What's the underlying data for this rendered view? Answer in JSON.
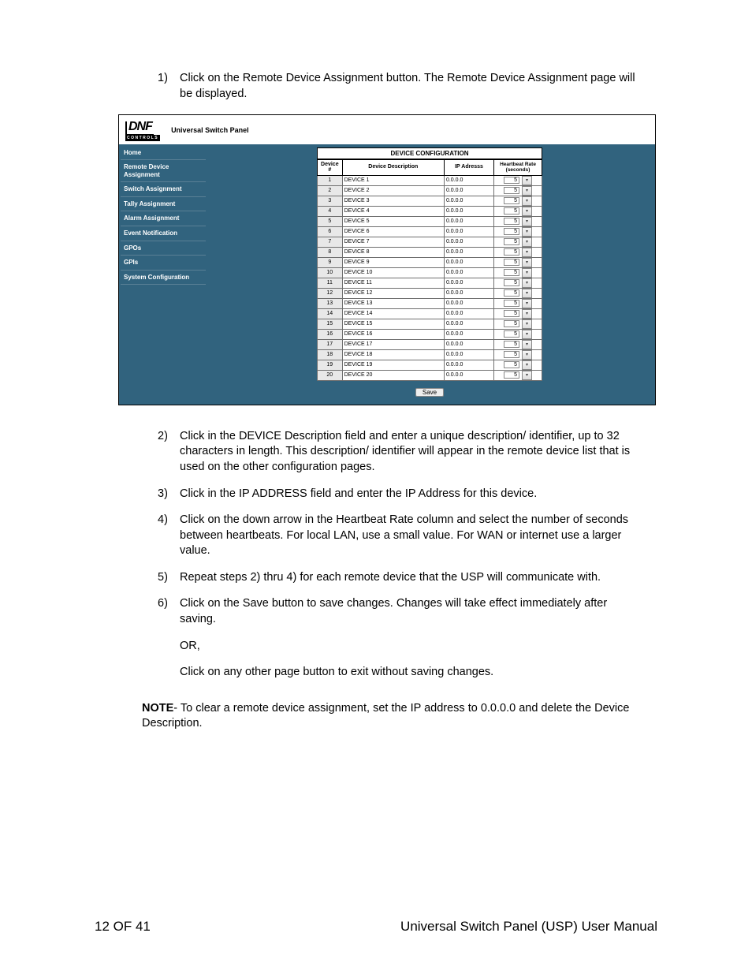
{
  "instructions": {
    "i1": {
      "num": "1)",
      "text": "Click on the Remote Device Assignment button. The Remote Device Assignment page will be displayed."
    },
    "i2": {
      "num": "2)",
      "text": "Click in the DEVICE Description field and enter a unique description/ identifier, up to 32 characters in length.  This description/ identifier will appear in the remote device list that is used on the other configuration pages."
    },
    "i3": {
      "num": "3)",
      "text": "Click in the IP ADDRESS field and enter the IP Address for this device."
    },
    "i4": {
      "num": "4)",
      "text": "Click on the down arrow in the Heartbeat Rate column and select the number of seconds between heartbeats.  For local LAN, use a small value.  For WAN or internet use a larger value."
    },
    "i5": {
      "num": "5)",
      "text": "Repeat steps 2) thru 4) for each remote device that the USP will communicate with."
    },
    "i6": {
      "num": "6)",
      "text": "Click on the Save button to save changes.  Changes will take effect immediately after saving."
    },
    "or": "OR,",
    "sub": "Click on any other page button to exit without saving changes."
  },
  "note_label": "NOTE",
  "note_text": "- To clear a remote device assignment, set the IP address to 0.0.0.0 and delete the Device Description.",
  "screenshot": {
    "logo_main": "DNF",
    "logo_sub": "CONTROLS",
    "top_title": "Universal Switch Panel",
    "sidebar": [
      "Home",
      "Remote Device Assignment",
      "Switch Assignment",
      "Tally Assignment",
      "Alarm Assignment",
      "Event Notification",
      "GPOs",
      "GPIs",
      "System Configuration"
    ],
    "config_title": "DEVICE CONFIGURATION",
    "headers": {
      "num": "Device #",
      "desc": "Device Description",
      "ip": "IP Adresss",
      "hb": "Heartbeat Rate (seconds)"
    },
    "rows": [
      {
        "n": "1",
        "d": "DEVICE 1",
        "ip": "0.0.0.0",
        "hb": "5"
      },
      {
        "n": "2",
        "d": "DEVICE 2",
        "ip": "0.0.0.0",
        "hb": "5"
      },
      {
        "n": "3",
        "d": "DEVICE 3",
        "ip": "0.0.0.0",
        "hb": "5"
      },
      {
        "n": "4",
        "d": "DEVICE 4",
        "ip": "0.0.0.0",
        "hb": "5"
      },
      {
        "n": "5",
        "d": "DEVICE 5",
        "ip": "0.0.0.0",
        "hb": "5"
      },
      {
        "n": "6",
        "d": "DEVICE 6",
        "ip": "0.0.0.0",
        "hb": "5"
      },
      {
        "n": "7",
        "d": "DEVICE 7",
        "ip": "0.0.0.0",
        "hb": "5"
      },
      {
        "n": "8",
        "d": "DEVICE 8",
        "ip": "0.0.0.0",
        "hb": "5"
      },
      {
        "n": "9",
        "d": "DEVICE 9",
        "ip": "0.0.0.0",
        "hb": "5"
      },
      {
        "n": "10",
        "d": "DEVICE 10",
        "ip": "0.0.0.0",
        "hb": "5"
      },
      {
        "n": "11",
        "d": "DEVICE 11",
        "ip": "0.0.0.0",
        "hb": "5"
      },
      {
        "n": "12",
        "d": "DEVICE 12",
        "ip": "0.0.0.0",
        "hb": "5"
      },
      {
        "n": "13",
        "d": "DEVICE 13",
        "ip": "0.0.0.0",
        "hb": "5"
      },
      {
        "n": "14",
        "d": "DEVICE 14",
        "ip": "0.0.0.0",
        "hb": "5"
      },
      {
        "n": "15",
        "d": "DEVICE 15",
        "ip": "0.0.0.0",
        "hb": "5"
      },
      {
        "n": "16",
        "d": "DEVICE 16",
        "ip": "0.0.0.0",
        "hb": "5"
      },
      {
        "n": "17",
        "d": "DEVICE 17",
        "ip": "0.0.0.0",
        "hb": "5"
      },
      {
        "n": "18",
        "d": "DEVICE 18",
        "ip": "0.0.0.0",
        "hb": "5"
      },
      {
        "n": "19",
        "d": "DEVICE 19",
        "ip": "0.0.0.0",
        "hb": "5"
      },
      {
        "n": "20",
        "d": "DEVICE 20",
        "ip": "0.0.0.0",
        "hb": "5"
      }
    ],
    "save_label": "Save"
  },
  "footer": {
    "left": "12 OF 41",
    "right": "Universal Switch Panel (USP) User Manual"
  }
}
